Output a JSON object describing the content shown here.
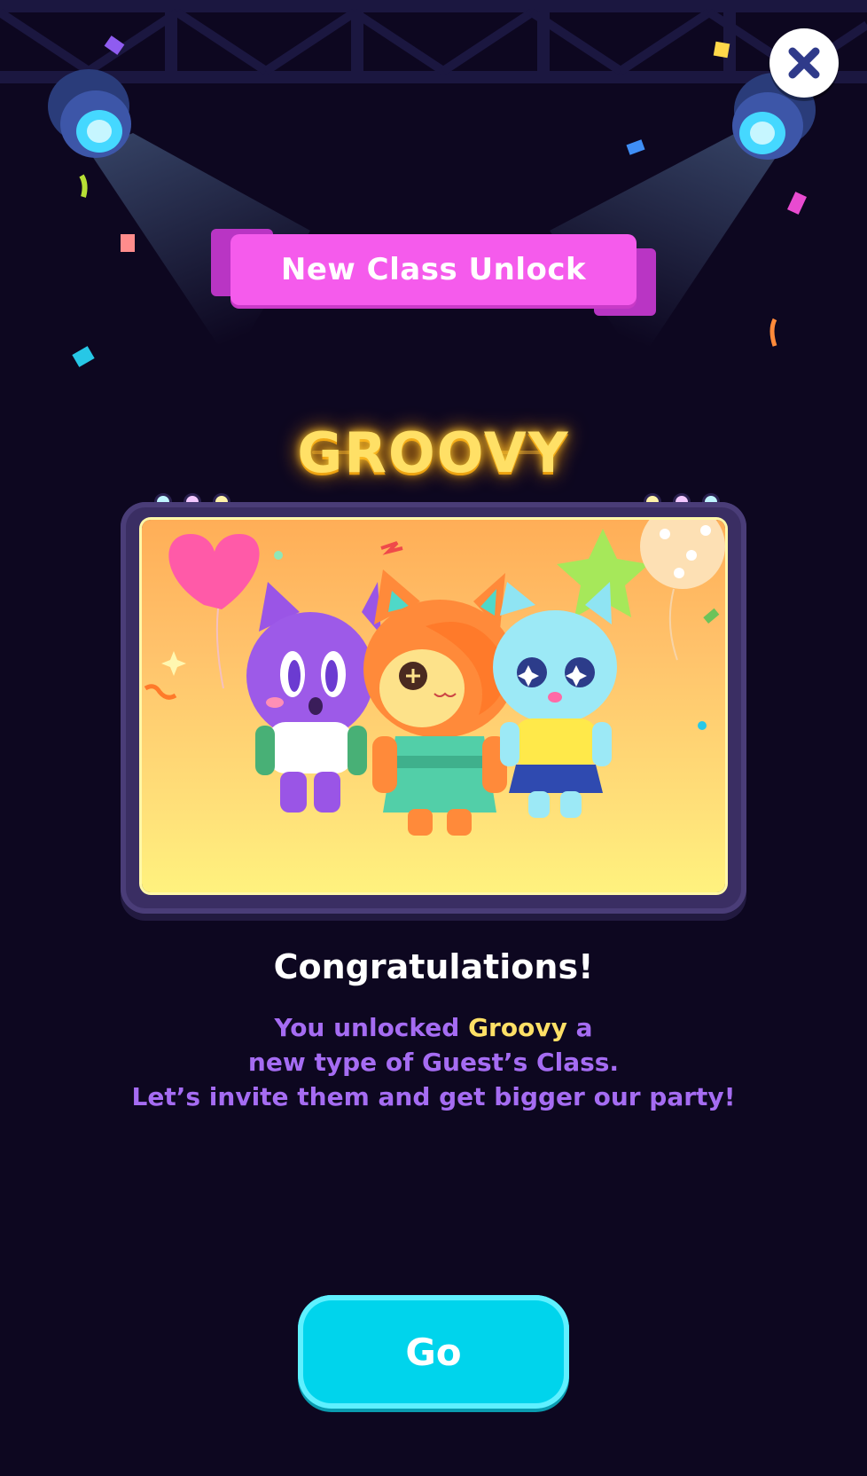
{
  "banner": {
    "label": "New Class Unlock"
  },
  "reward": {
    "title": "GROOVY"
  },
  "message": {
    "heading": "Congratulations!",
    "line1_pre": "You unlocked ",
    "line1_highlight": "Groovy",
    "line1_post": " a",
    "line2": "new type of Guest’s Class.",
    "line3": "Let’s invite them and get bigger our party!"
  },
  "actions": {
    "go_label": "Go",
    "close_icon": "close-icon"
  },
  "colors": {
    "background": "#0d0720",
    "banner": "#f55bec",
    "title_glow": "#ffe066",
    "text_purple": "#a56cf2",
    "highlight_yellow": "#ffe066",
    "go_button": "#00d4ec"
  }
}
